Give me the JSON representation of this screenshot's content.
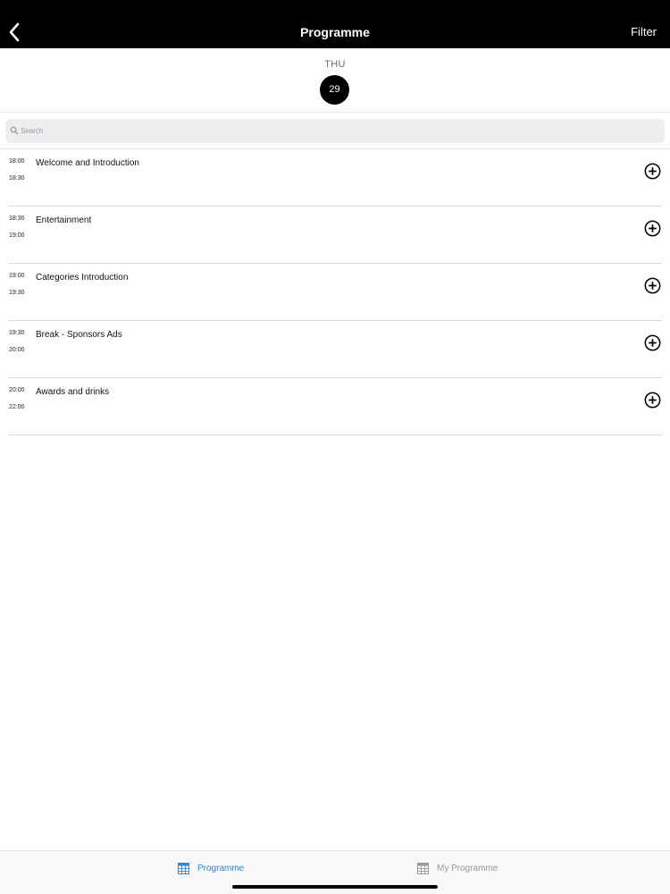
{
  "navbar": {
    "title": "Programme",
    "filter_label": "Filter",
    "back_icon": "chevron-left-icon",
    "background": "#000000"
  },
  "date_strip": {
    "day_name": "THU",
    "day_number": "29"
  },
  "search": {
    "placeholder": "Search",
    "value": "",
    "icon": "search-icon"
  },
  "sessions": [
    {
      "start": "18:00",
      "end": "18:30",
      "title": "Welcome and Introduction"
    },
    {
      "start": "18:30",
      "end": "19:00",
      "title": "Entertainment"
    },
    {
      "start": "19:00",
      "end": "19:30",
      "title": "Categories Introduction"
    },
    {
      "start": "19:30",
      "end": "20:00",
      "title": "Break - Sponsors Ads"
    },
    {
      "start": "20:00",
      "end": "22:00",
      "title": "Awards and drinks"
    }
  ],
  "tabbar": {
    "tabs": [
      {
        "label": "Programme",
        "icon": "calendar-icon",
        "active": true
      },
      {
        "label": "My Programme",
        "icon": "calendar-icon",
        "active": false
      }
    ],
    "active_color": "#2f88d8",
    "inactive_color": "#9a9a9a"
  }
}
